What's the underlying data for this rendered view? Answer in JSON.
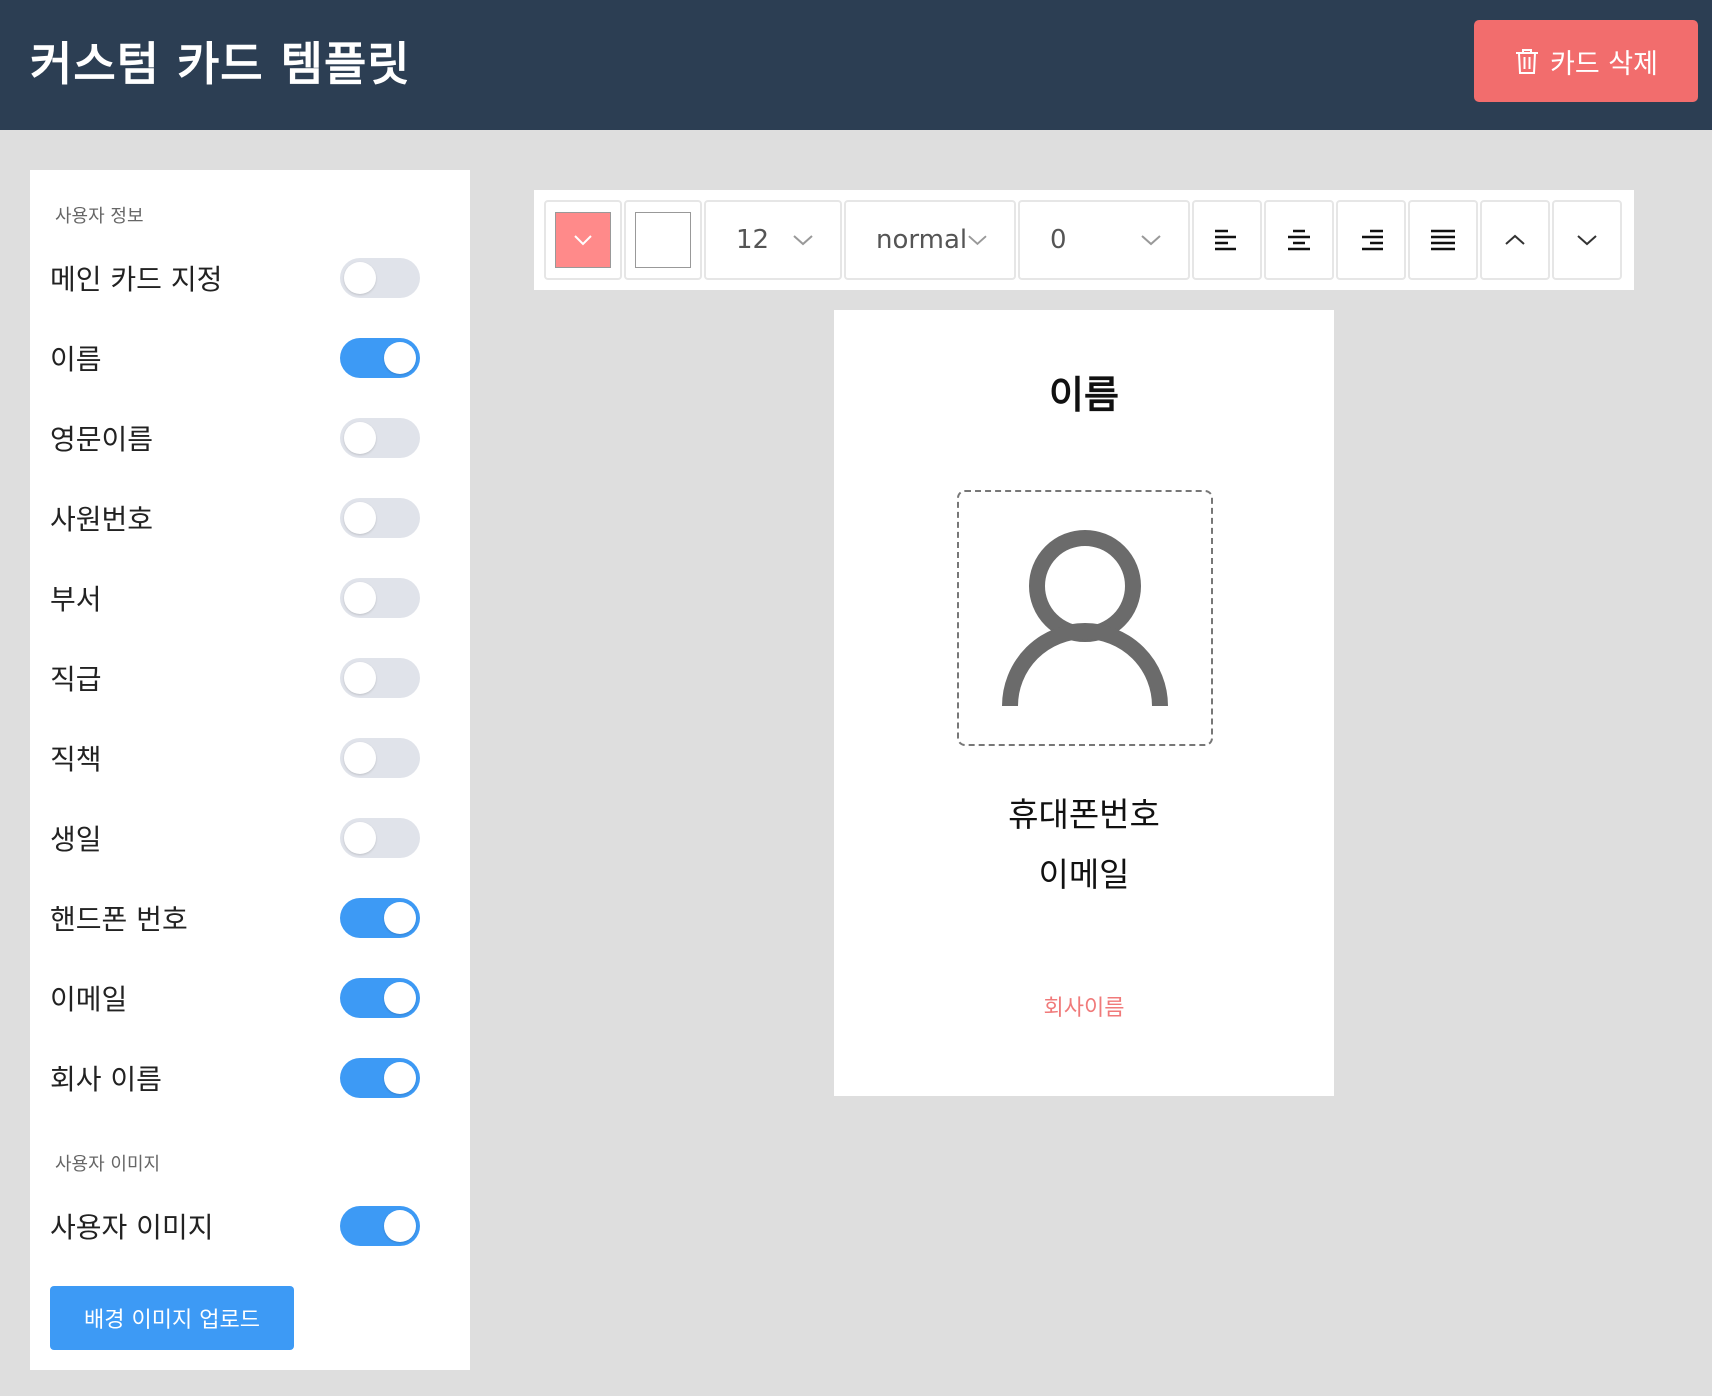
{
  "header": {
    "title": "커스텀 카드 템플릿",
    "delete_label": "카드 삭제"
  },
  "sidebar": {
    "user_info_label": "사용자 정보",
    "toggles": [
      {
        "label": "메인 카드 지정",
        "on": false
      },
      {
        "label": "이름",
        "on": true
      },
      {
        "label": "영문이름",
        "on": false
      },
      {
        "label": "사원번호",
        "on": false
      },
      {
        "label": "부서",
        "on": false
      },
      {
        "label": "직급",
        "on": false
      },
      {
        "label": "직책",
        "on": false
      },
      {
        "label": "생일",
        "on": false
      },
      {
        "label": "핸드폰 번호",
        "on": true
      },
      {
        "label": "이메일",
        "on": true
      },
      {
        "label": "회사 이름",
        "on": true
      }
    ],
    "user_image_label": "사용자 이미지",
    "user_image_toggle": {
      "label": "사용자 이미지",
      "on": true
    },
    "upload_label": "배경 이미지 업로드"
  },
  "toolbar": {
    "fill_color": "#ff8a8a",
    "text_color": "#ffffff",
    "font_size": "12",
    "font_weight": "normal",
    "letter_spacing": "0",
    "icons": [
      "align-left-icon",
      "align-center-icon",
      "align-right-icon",
      "align-justify-icon",
      "chevron-up-icon",
      "chevron-down-icon"
    ]
  },
  "card": {
    "name": "이름",
    "phone": "휴대폰번호",
    "email": "이메일",
    "company": "회사이름",
    "avatar_icon": "user-icon"
  },
  "colors": {
    "header_bg": "#2c3e53",
    "accent": "#3d9af5",
    "danger": "#f26d6d"
  }
}
